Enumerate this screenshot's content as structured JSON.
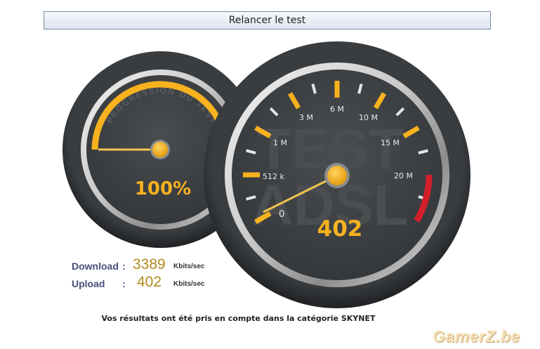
{
  "retest_button": {
    "label": "Relancer le test"
  },
  "progress_gauge": {
    "arc_text": "PROGRESSION DU TEST",
    "value_text": "100%",
    "percent": 100
  },
  "speed_gauge": {
    "watermark_line1": "TEST",
    "watermark_line2": "ADSL",
    "value_text": "402",
    "needle_value_kbps": 402,
    "scale_labels": [
      "0",
      "512 k",
      "1 M",
      "3 M",
      "6 M",
      "10 M",
      "15 M",
      "20 M"
    ]
  },
  "results": {
    "download_label": "Download",
    "download_value": "3389",
    "upload_label": "Upload",
    "upload_value": "402",
    "separator": ":",
    "unit": "Kbits/sec"
  },
  "footer_note": "Vos résultats ont été pris en compte dans la catégorie SKYNET",
  "watermark_brand": "GamerZ.be",
  "colors": {
    "accent": "#f7b21e",
    "dial": "#3d4043",
    "redline": "#d41f2a",
    "value": "#b18a1e"
  }
}
